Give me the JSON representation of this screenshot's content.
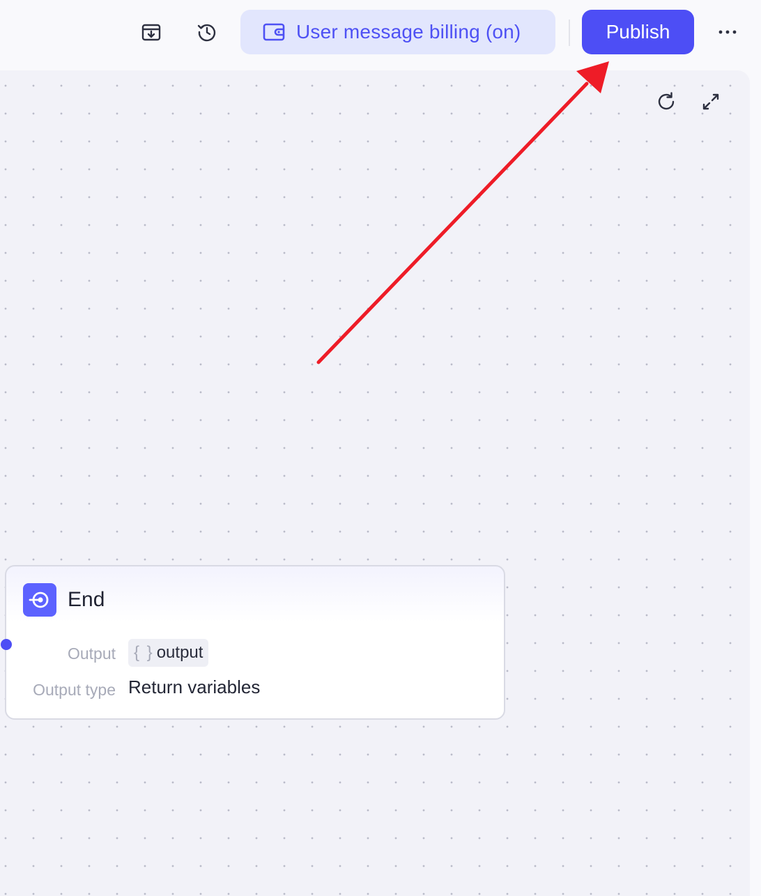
{
  "topbar": {
    "billing_label": "User message billing (on)",
    "publish_label": "Publish",
    "more_label": "···"
  },
  "node": {
    "title": "End",
    "output_label": "Output",
    "output_braces": "{ }",
    "output_value": "output",
    "output_type_label": "Output type",
    "output_type_value": "Return variables"
  },
  "colors": {
    "accent": "#4d4ef5",
    "billing_bg": "#e2e6fd",
    "annotation_arrow": "#ee1c27"
  }
}
